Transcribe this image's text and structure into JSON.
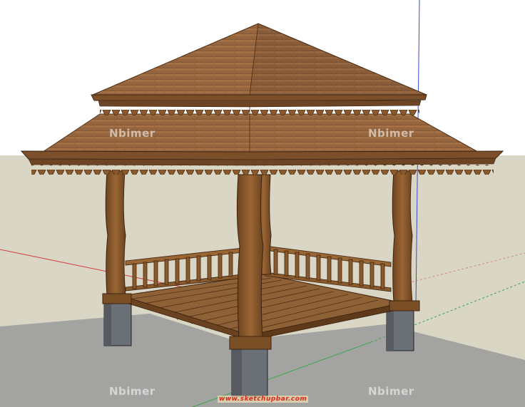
{
  "watermarks": [
    "Nbimer",
    "Nbimer",
    "Nbimer",
    "Nbimer"
  ],
  "site_url": "www.sketchupbar.com",
  "colors": {
    "sky": "#ffffff",
    "ground": "#d9d6c6",
    "shadow": "#a3a3a1",
    "roof": "#9b6a43",
    "roof_dark": "#7a4f30",
    "wood": "#8a5a2c",
    "wood_dark": "#5e3a1a",
    "concrete": "#686c73",
    "axis_red": "#d23a3a",
    "axis_green": "#3aa64a",
    "axis_blue": "#3a4ad2"
  }
}
